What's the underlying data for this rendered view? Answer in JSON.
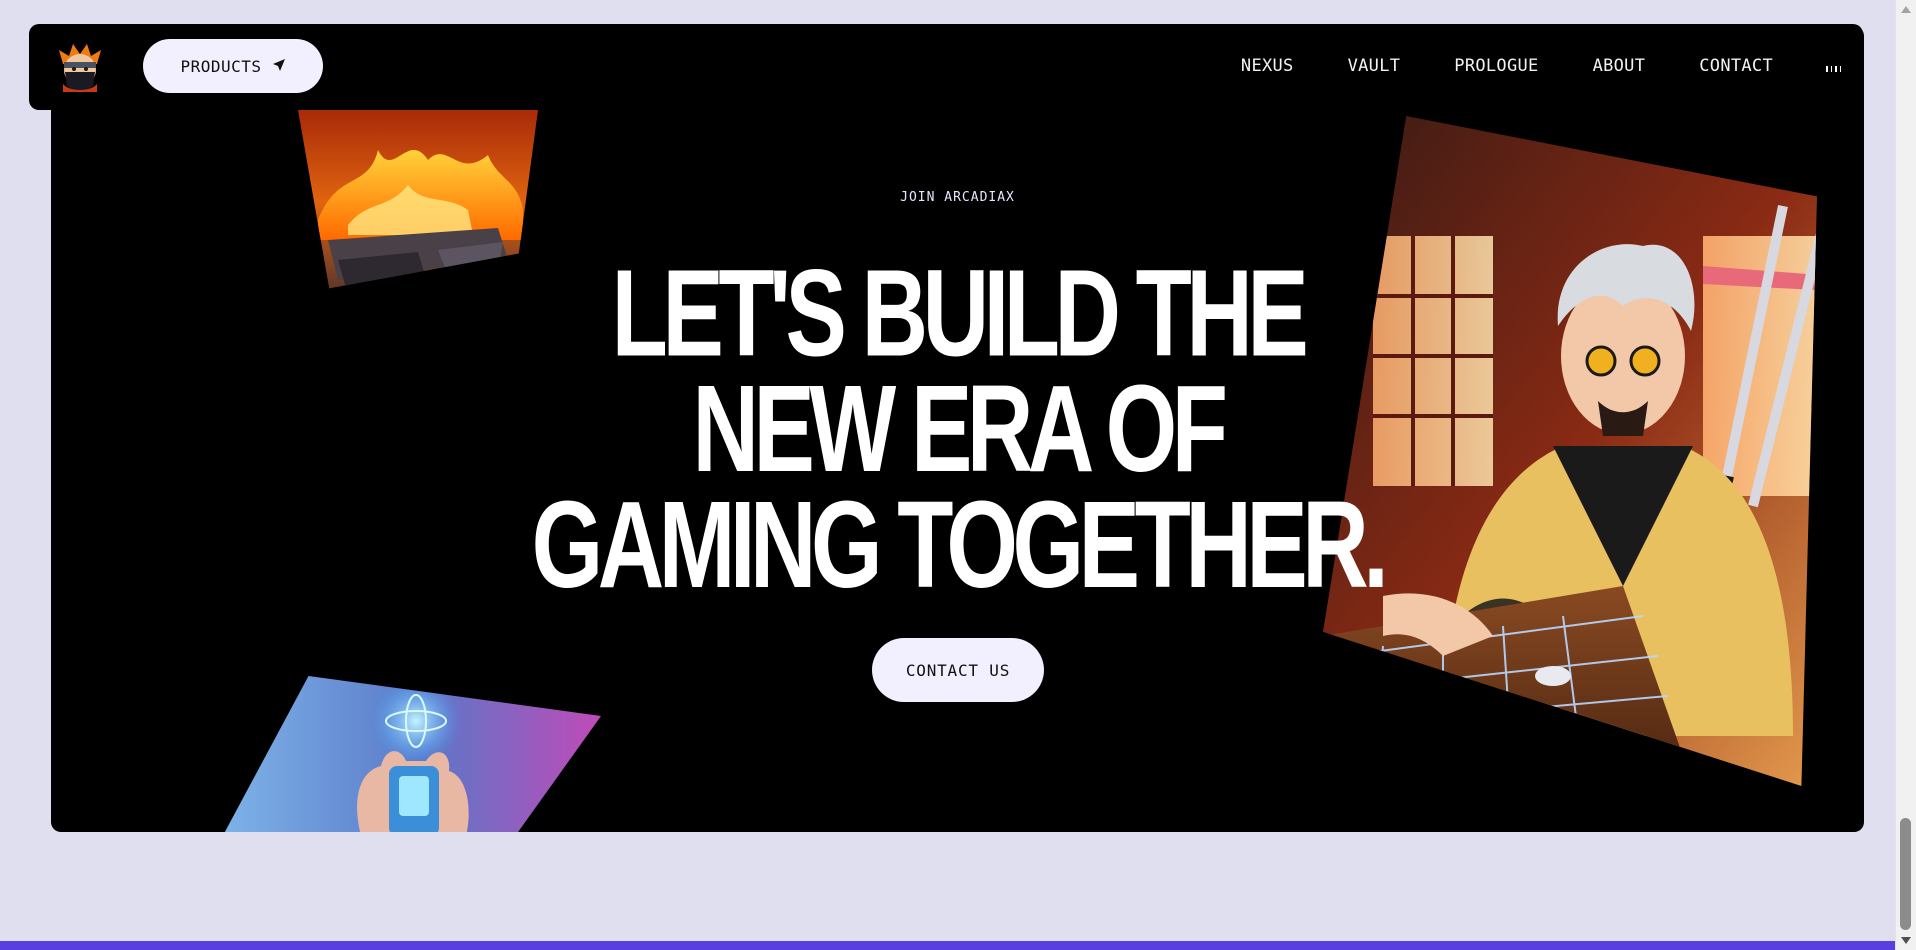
{
  "nav": {
    "products_label": "PRODUCTS",
    "links": [
      "NEXUS",
      "VAULT",
      "PROLOGUE",
      "ABOUT",
      "CONTACT"
    ]
  },
  "hero": {
    "kicker": "JOIN ARCADIAX",
    "headline_lines": [
      "LET'S BUILD THE",
      "NEW ERA OF",
      "GAMING TOGETHER."
    ],
    "cta_label": "CONTACT US"
  },
  "icons": {
    "logo": "ninja-logo-icon",
    "products": "paper-plane-icon",
    "audio": "audio-bars-icon"
  },
  "colors": {
    "page_background": "#dfdff0",
    "hero_background": "#000000",
    "button_background": "#f2f0ff",
    "bottom_stripe": "#5a3fe0"
  }
}
